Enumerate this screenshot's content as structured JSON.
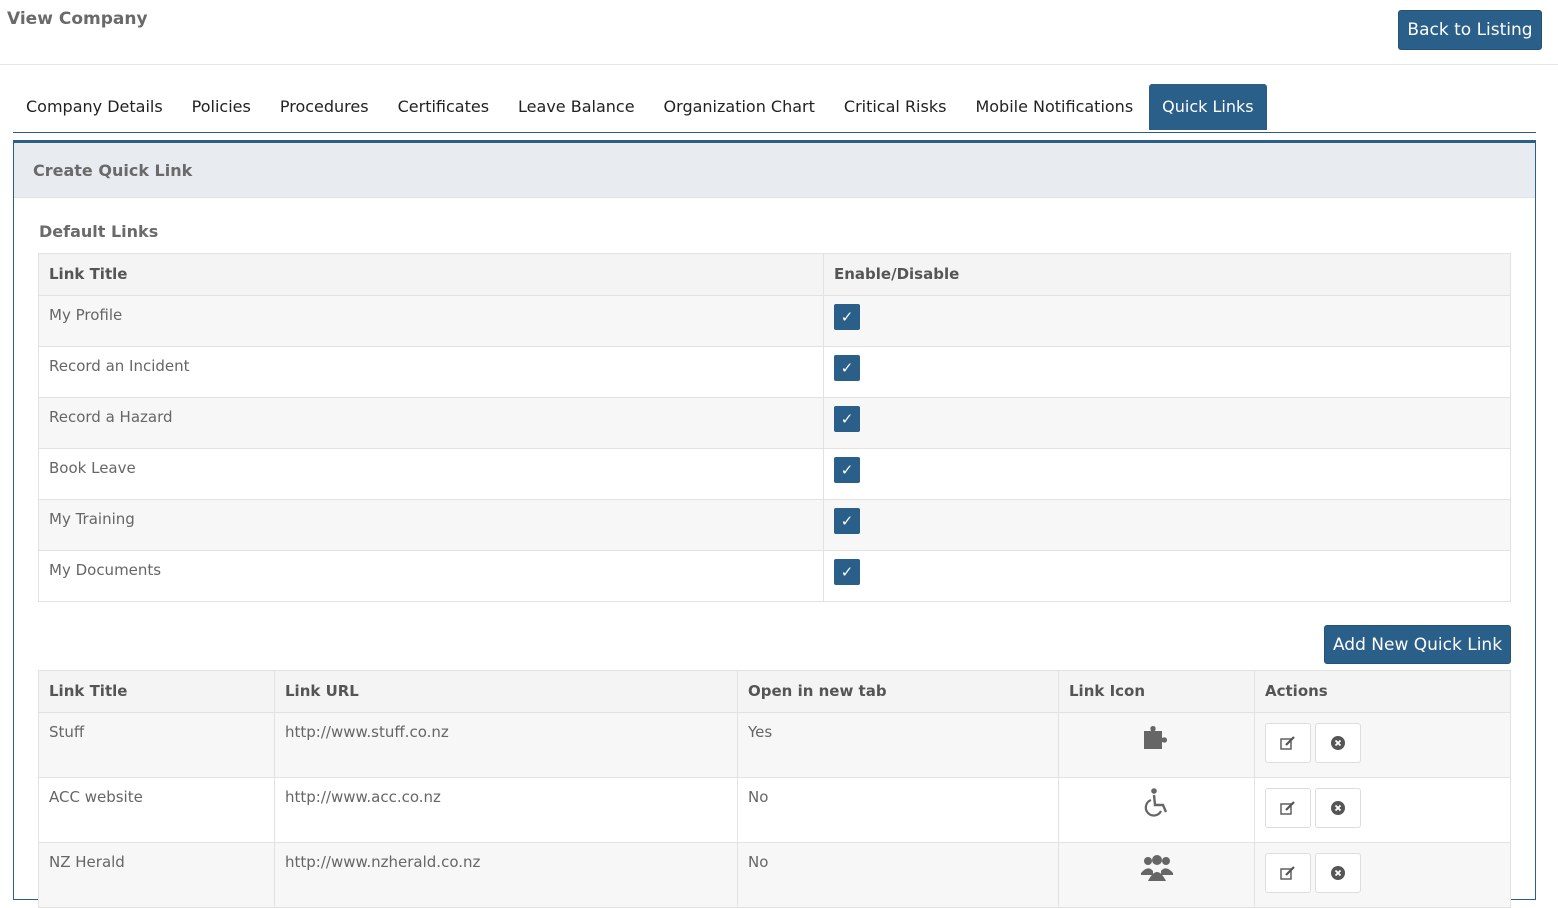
{
  "page_title": "View Company",
  "back_button": "Back to Listing",
  "tabs": [
    {
      "label": "Company Details",
      "active": false
    },
    {
      "label": "Policies",
      "active": false
    },
    {
      "label": "Procedures",
      "active": false
    },
    {
      "label": "Certificates",
      "active": false
    },
    {
      "label": "Leave Balance",
      "active": false
    },
    {
      "label": "Organization Chart",
      "active": false
    },
    {
      "label": "Critical Risks",
      "active": false
    },
    {
      "label": "Mobile Notifications",
      "active": false
    },
    {
      "label": "Quick Links",
      "active": true
    }
  ],
  "panel_title": "Create Quick Link",
  "default_links": {
    "section_title": "Default Links",
    "headers": [
      "Link Title",
      "Enable/Disable"
    ],
    "rows": [
      {
        "title": "My Profile",
        "enabled": true
      },
      {
        "title": "Record an Incident",
        "enabled": true
      },
      {
        "title": "Record a Hazard",
        "enabled": true
      },
      {
        "title": "Book Leave",
        "enabled": true
      },
      {
        "title": "My Training",
        "enabled": true
      },
      {
        "title": "My Documents",
        "enabled": true
      }
    ]
  },
  "add_button": "Add New Quick Link",
  "quick_links": {
    "headers": [
      "Link Title",
      "Link URL",
      "Open in new tab",
      "Link Icon",
      "Actions"
    ],
    "rows": [
      {
        "title": "Stuff",
        "url": "http://www.stuff.co.nz",
        "new_tab": "Yes",
        "icon": "puzzle-icon"
      },
      {
        "title": "ACC website",
        "url": "http://www.acc.co.nz",
        "new_tab": "No",
        "icon": "wheelchair-icon"
      },
      {
        "title": "NZ Herald",
        "url": "http://www.nzherald.co.nz",
        "new_tab": "No",
        "icon": "users-icon"
      }
    ]
  },
  "colors": {
    "accent": "#2a5f8a",
    "panel_header": "#e8ecf0",
    "icon_gray": "#666666"
  }
}
